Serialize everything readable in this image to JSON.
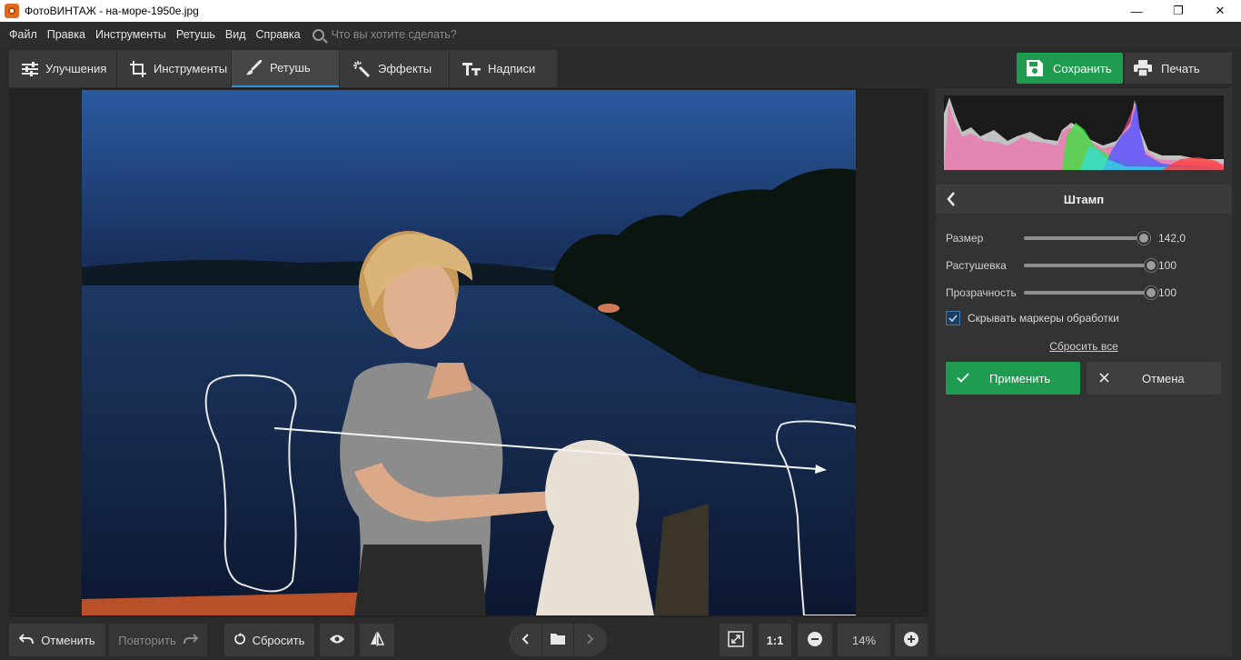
{
  "window": {
    "title": "ФотоВИНТАЖ - на-море-1950е.jpg",
    "controls": {
      "minimize": "—",
      "maximize": "❐",
      "close": "✕"
    }
  },
  "menu": {
    "items": [
      "Файл",
      "Правка",
      "Инструменты",
      "Ретушь",
      "Вид",
      "Справка"
    ],
    "search_placeholder": "Что вы хотите сделать?"
  },
  "tabs": [
    {
      "label": "Улучшения",
      "icon": "sliders-icon"
    },
    {
      "label": "Инструменты",
      "icon": "crop-icon"
    },
    {
      "label": "Ретушь",
      "icon": "brush-icon",
      "active": true
    },
    {
      "label": "Эффекты",
      "icon": "magic-wand-icon"
    },
    {
      "label": "Надписи",
      "icon": "text-icon"
    }
  ],
  "actions": {
    "save": "Сохранить",
    "print": "Печать"
  },
  "bottom": {
    "undo": "Отменить",
    "redo": "Повторить",
    "reset": "Сбросить",
    "zoom_one": "1:1",
    "zoom_value": "14%"
  },
  "panel": {
    "title": "Штамп",
    "sliders": [
      {
        "label": "Размер",
        "value_text": "142,0",
        "fraction": 0.94
      },
      {
        "label": "Растушевка",
        "value_text": "100",
        "fraction": 1.0
      },
      {
        "label": "Прозрачность",
        "value_text": "100",
        "fraction": 1.0
      }
    ],
    "checkbox_label": "Скрывать маркеры обработки",
    "checkbox_checked": true,
    "reset_all": "Сбросить все",
    "apply": "Применить",
    "cancel": "Отмена"
  },
  "colors": {
    "accent_green": "#1e9b4f",
    "tab_underline": "#2f8fd6"
  }
}
